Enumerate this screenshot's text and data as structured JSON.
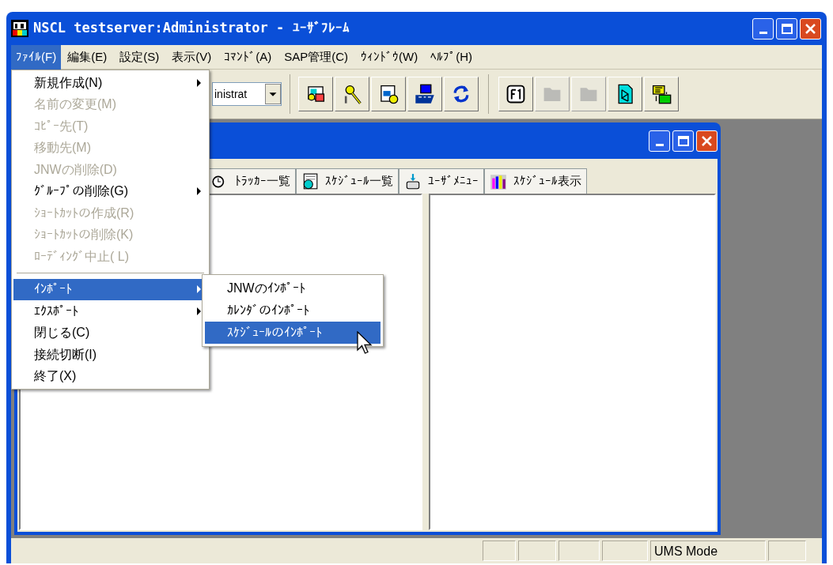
{
  "window": {
    "title": "NSCL testserver:Administrator - ﾕｰｻﾞﾌﾚｰﾑ"
  },
  "menu_bar": [
    {
      "label": "ﾌｧｲﾙ(F)",
      "selected": true
    },
    {
      "label": "編集(E)",
      "selected": false
    },
    {
      "label": "設定(S)",
      "selected": false
    },
    {
      "label": "表示(V)",
      "selected": false
    },
    {
      "label": "ｺﾏﾝﾄﾞ(A)",
      "selected": false
    },
    {
      "label": "SAP管理(C)",
      "selected": false
    },
    {
      "label": "ｳｨﾝﾄﾞｳ(W)",
      "selected": false
    },
    {
      "label": "ﾍﾙﾌﾟ(H)",
      "selected": false
    }
  ],
  "toolbar": {
    "combo_value": "inistrat",
    "buttons": [
      {
        "kind": "network",
        "disabled": false
      },
      {
        "kind": "keys",
        "disabled": false
      },
      {
        "kind": "computer",
        "disabled": false
      },
      {
        "kind": "sap",
        "disabled": false
      },
      {
        "kind": "refresh",
        "disabled": false
      },
      {
        "kind": "separator"
      },
      {
        "kind": "help",
        "disabled": false
      },
      {
        "kind": "folder",
        "disabled": true
      },
      {
        "kind": "folder",
        "disabled": true
      },
      {
        "kind": "diagram",
        "disabled": false
      },
      {
        "kind": "job",
        "disabled": false
      }
    ]
  },
  "file_menu": [
    {
      "kind": "item",
      "label": "新規作成(N)",
      "disabled": false,
      "submenu": true,
      "selected": false
    },
    {
      "kind": "item",
      "label": "名前の変更(M)",
      "disabled": true,
      "submenu": false,
      "selected": false
    },
    {
      "kind": "item",
      "label": "ｺﾋﾟｰ先(T)",
      "disabled": true,
      "submenu": false,
      "selected": false
    },
    {
      "kind": "item",
      "label": "移動先(M)",
      "disabled": true,
      "submenu": false,
      "selected": false
    },
    {
      "kind": "item",
      "label": "JNWの削除(D)",
      "disabled": true,
      "submenu": false,
      "selected": false
    },
    {
      "kind": "item",
      "label": "ｸﾞﾙｰﾌﾟの削除(G)",
      "disabled": false,
      "submenu": true,
      "selected": false
    },
    {
      "kind": "item",
      "label": "ｼｮｰﾄｶｯﾄの作成(R)",
      "disabled": true,
      "submenu": false,
      "selected": false
    },
    {
      "kind": "item",
      "label": "ｼｮｰﾄｶｯﾄの削除(K)",
      "disabled": true,
      "submenu": false,
      "selected": false
    },
    {
      "kind": "item",
      "label": "ﾛｰﾃﾞｨﾝｸﾞ中止( L)",
      "disabled": true,
      "submenu": false,
      "selected": false
    },
    {
      "kind": "separator"
    },
    {
      "kind": "item",
      "label": "ｲﾝﾎﾟｰﾄ",
      "disabled": false,
      "submenu": true,
      "selected": true
    },
    {
      "kind": "item",
      "label": "ｴｸｽﾎﾟｰﾄ",
      "disabled": false,
      "submenu": true,
      "selected": false
    },
    {
      "kind": "item",
      "label": "閉じる(C)",
      "disabled": false,
      "submenu": false,
      "selected": false
    },
    {
      "kind": "item",
      "label": "接続切断(I)",
      "disabled": false,
      "submenu": false,
      "selected": false
    },
    {
      "kind": "item",
      "label": "終了(X)",
      "disabled": false,
      "submenu": false,
      "selected": false
    }
  ],
  "import_submenu": [
    {
      "label": "JNWのｲﾝﾎﾟｰﾄ",
      "selected": false
    },
    {
      "label": "ｶﾚﾝﾀﾞのｲﾝﾎﾟｰﾄ",
      "selected": false
    },
    {
      "label": "ｽｹｼﾞｭｰﾙのｲﾝﾎﾟｰﾄ",
      "selected": true
    }
  ],
  "child_window": {
    "tabs": [
      {
        "kind": "tracker",
        "label": "ﾄﾗｯｶｰ一覧",
        "selected": false
      },
      {
        "kind": "schedule",
        "label": "ｽｹｼﾞｭｰﾙ一覧",
        "selected": false
      },
      {
        "kind": "user",
        "label": "ﾕｰｻﾞﾒﾆｭｰ",
        "selected": false
      },
      {
        "kind": "chart",
        "label": "ｽｹｼﾞｭｰﾙ表示",
        "selected": false
      }
    ]
  },
  "status_bar": {
    "mode": "UMS Mode"
  }
}
